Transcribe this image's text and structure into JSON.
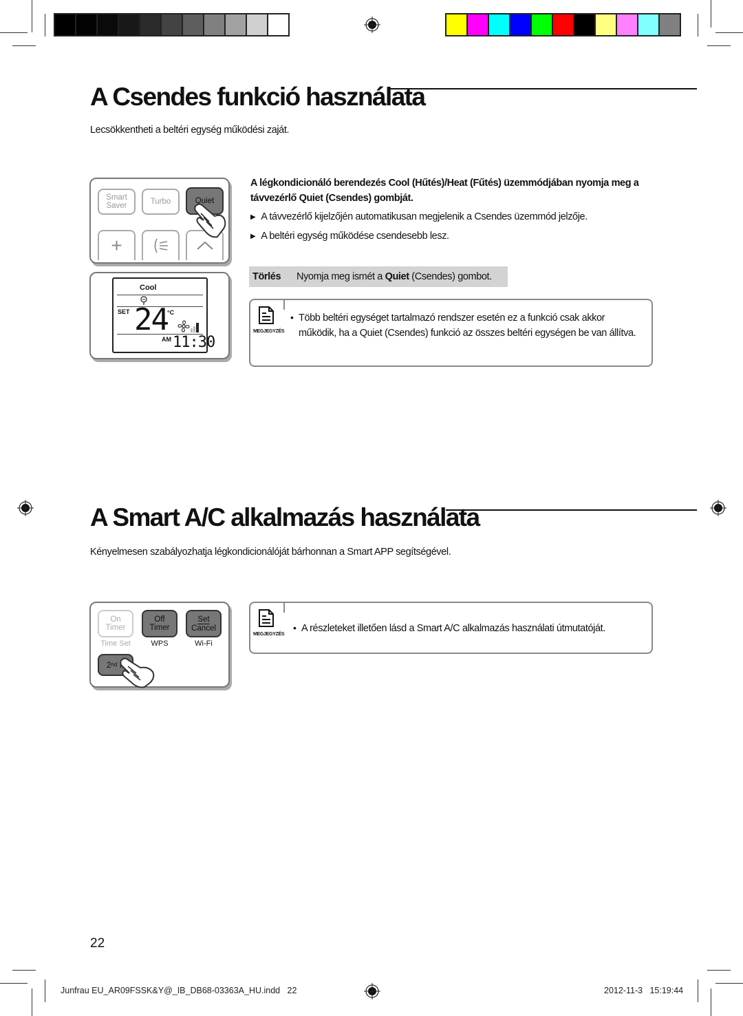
{
  "print_marks": {
    "grayscale_bar": [
      "#000000",
      "#030303",
      "#0a0a0a",
      "#181818",
      "#2b2b2b",
      "#434343",
      "#5e5e5e",
      "#808080",
      "#a2a2a2",
      "#d0d0d0",
      "#ffffff"
    ],
    "color_bar": [
      "#ffff00",
      "#ff00ff",
      "#00ffff",
      "#0000ff",
      "#00ff00",
      "#ff0000",
      "#000000",
      "#ffff80",
      "#ff80ff",
      "#80ffff",
      "#808080"
    ]
  },
  "section1": {
    "title": "A Csendes funkció használata",
    "intro": "Lecsökkentheti a beltéri egység működési zaját.",
    "remote": {
      "buttons": [
        {
          "line1": "Smart",
          "line2": "Saver",
          "active": false
        },
        {
          "line1": "Turbo",
          "line2": "",
          "active": false
        },
        {
          "line1": "Quiet",
          "line2": "",
          "active": true
        }
      ],
      "display": {
        "mode": "Cool",
        "set_label": "SET",
        "temperature": "24",
        "unit": "°C",
        "am_pm": "AM",
        "time": "11:30"
      }
    },
    "instruction": {
      "part1": "A légkondicionáló berendezés Cool (Hűtés)/Heat (Fűtés) üzemmódjában nyomja meg a távvezérlő ",
      "bold": "Quiet",
      "part2": " (Csendes) gombját."
    },
    "bullets": [
      "A távvezérlő kijelzőjén automatikusan megjelenik a Csendes üzemmód jelzője.",
      "A beltéri egység működése csendesebb lesz."
    ],
    "cancel": {
      "label": "Törlés",
      "text1": "Nyomja meg ismét a ",
      "bold": "Quiet",
      "text2": " (Csendes) gombot."
    },
    "note": {
      "tag": "MEGJEGYZÉS",
      "text": "Több beltéri egységet tartalmazó rendszer esetén ez a funkció csak akkor működik, ha a Quiet (Csendes) funkció az összes beltéri egységen be van állítva."
    }
  },
  "section2": {
    "title": "A Smart A/C alkalmazás használata",
    "intro": "Kényelmesen szabályozhatja légkondicionálóját bárhonnan a Smart APP segítségével.",
    "remote": {
      "buttons": [
        {
          "line1": "On",
          "line2": "Timer",
          "sub": "Time Set",
          "active": false
        },
        {
          "line1": "Off",
          "line2": "Timer",
          "sub": "WPS",
          "active": true
        },
        {
          "line1": "Set",
          "line2": "Cancel",
          "sub": "Wi-Fi",
          "active": true
        }
      ],
      "second_function": {
        "base": "2",
        "sup": "nd",
        "rest": " F"
      }
    },
    "note": {
      "tag": "MEGJEGYZÉS",
      "text": "A részleteket illetően lásd a Smart A/C alkalmazás használati útmutatóját."
    }
  },
  "page_number": "22",
  "footer": {
    "file": "Junfrau EU_AR09FSSK&Y@_IB_DB68-03363A_HU.indd   22",
    "timestamp": "2012-11-3   15:19:44"
  }
}
